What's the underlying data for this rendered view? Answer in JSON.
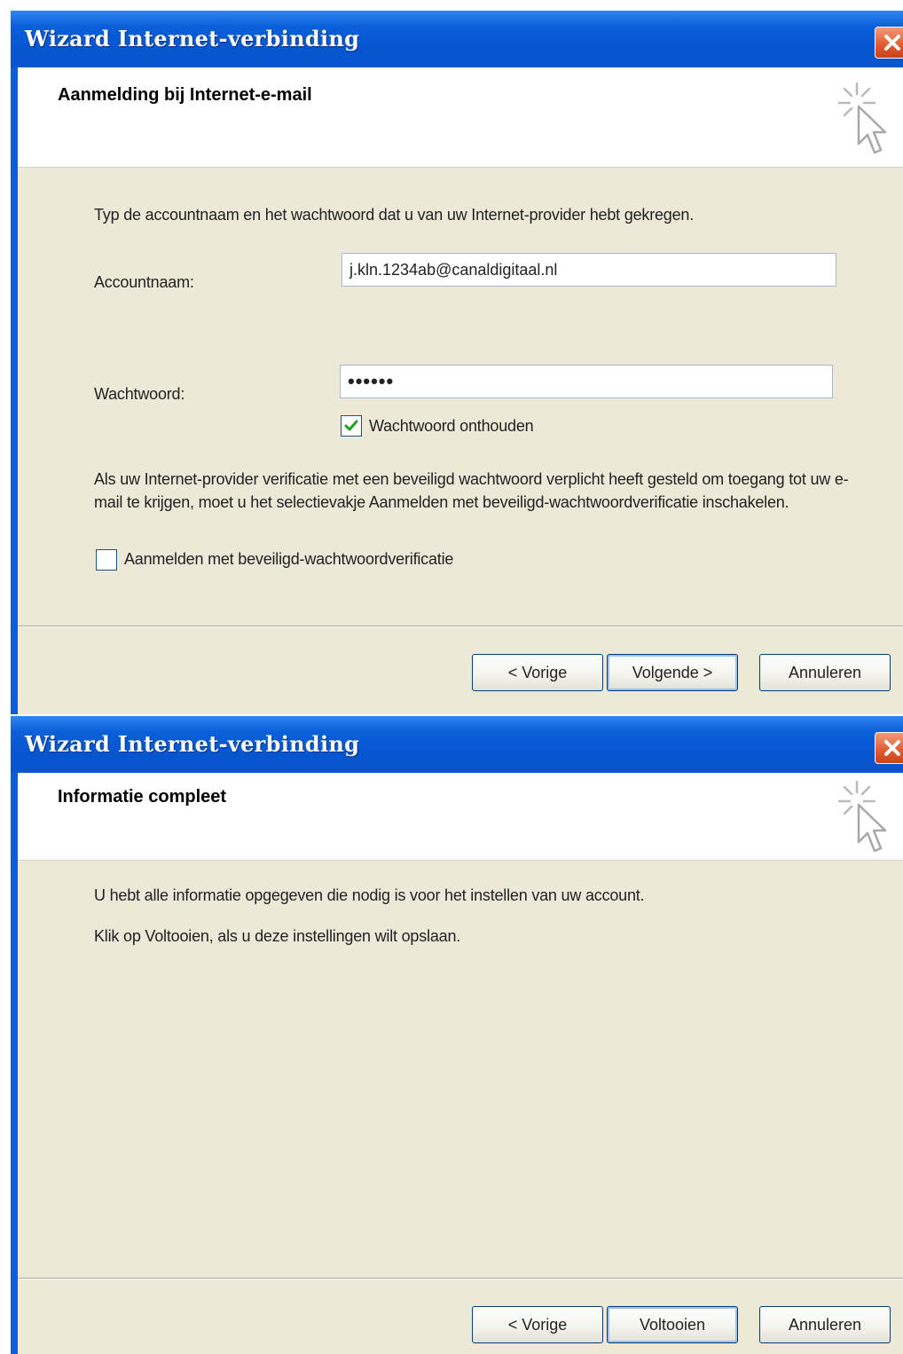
{
  "dialog1": {
    "title": "Wizard Internet-verbinding",
    "header_title": "Aanmelding bij Internet-e-mail",
    "intro": "Typ de accountnaam en het wachtwoord dat u van uw Internet-provider hebt gekregen.",
    "account_label": "Accountnaam:",
    "account_value": "j.kln.1234ab@canaldigitaal.nl",
    "password_label": "Wachtwoord:",
    "password_value": "••••••",
    "remember_label": "Wachtwoord onthouden",
    "remember_checked": true,
    "spa_info": "Als uw Internet-provider verificatie met een beveiligd wachtwoord verplicht heeft gesteld om toegang tot uw e-mail te krijgen, moet u het selectievakje Aanmelden met beveiligd-wachtwoordverificatie inschakelen.",
    "spa_label": "Aanmelden met beveiligd-wachtwoordverificatie",
    "spa_checked": false,
    "back_button": "< Vorige",
    "next_button": "Volgende >",
    "cancel_button": "Annuleren"
  },
  "dialog2": {
    "title": "Wizard Internet-verbinding",
    "header_title": "Informatie compleet",
    "line1": "U hebt alle informatie opgegeven die nodig is voor het instellen van uw account.",
    "line2": "Klik op Voltooien, als u deze instellingen wilt opslaan.",
    "back_button": "< Vorige",
    "finish_button": "Voltooien",
    "cancel_button": "Annuleren"
  },
  "colors": {
    "titlebar": "#0a5fd8",
    "dialog_bg": "#ece9d8",
    "close_button": "#e05a2e",
    "checkmark": "#21a121"
  },
  "icons": {
    "close": "close-icon",
    "wizard": "wizard-cursor-icon",
    "check": "checkmark-icon"
  }
}
